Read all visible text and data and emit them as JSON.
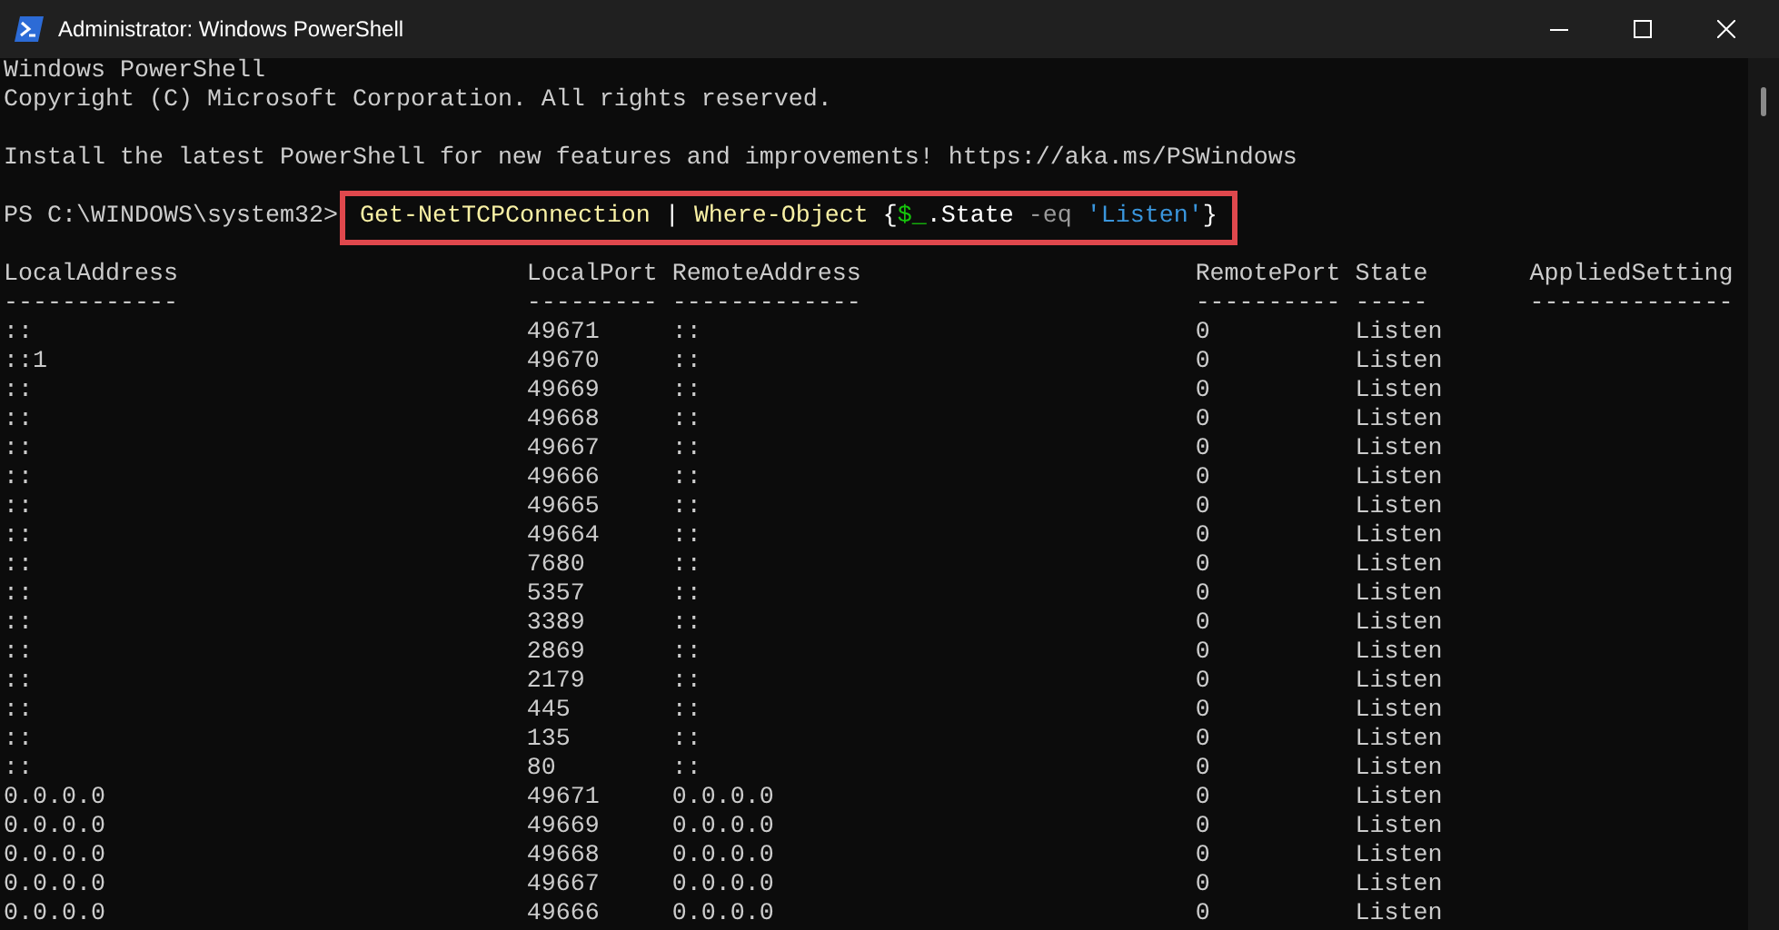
{
  "window": {
    "title": "Administrator: Windows PowerShell"
  },
  "console": {
    "banner": [
      [
        "Windows PowerShell",
        "Copyright (C) Microsoft Corporation. All rights reserved."
      ],
      [
        "Install the latest PowerShell for new features and improvements! https://aka.ms/PSWindows"
      ]
    ],
    "prompt": "PS C:\\WINDOWS\\system32>",
    "command": {
      "highlighted": true,
      "segments": [
        {
          "kind": "command",
          "text": "Get-NetTCPConnection"
        },
        {
          "kind": "plain",
          "text": " | "
        },
        {
          "kind": "command",
          "text": "Where-Object"
        },
        {
          "kind": "plain",
          "text": " {"
        },
        {
          "kind": "variable",
          "text": "$_"
        },
        {
          "kind": "plain",
          "text": ".State "
        },
        {
          "kind": "operator",
          "text": "-eq "
        },
        {
          "kind": "string",
          "text": "'Listen'"
        },
        {
          "kind": "plain",
          "text": "}"
        }
      ]
    },
    "table": {
      "columns": [
        {
          "header": "LocalAddress",
          "underline": "------------"
        },
        {
          "header": "LocalPort",
          "underline": "---------"
        },
        {
          "header": "RemoteAddress",
          "underline": "-------------"
        },
        {
          "header": "RemotePort",
          "underline": "----------"
        },
        {
          "header": "State",
          "underline": "-----"
        },
        {
          "header": "AppliedSetting",
          "underline": "--------------"
        }
      ],
      "rows": [
        [
          "::",
          "49671",
          "::",
          "0",
          "Listen"
        ],
        [
          "::1",
          "49670",
          "::",
          "0",
          "Listen"
        ],
        [
          "::",
          "49669",
          "::",
          "0",
          "Listen"
        ],
        [
          "::",
          "49668",
          "::",
          "0",
          "Listen"
        ],
        [
          "::",
          "49667",
          "::",
          "0",
          "Listen"
        ],
        [
          "::",
          "49666",
          "::",
          "0",
          "Listen"
        ],
        [
          "::",
          "49665",
          "::",
          "0",
          "Listen"
        ],
        [
          "::",
          "49664",
          "::",
          "0",
          "Listen"
        ],
        [
          "::",
          "7680",
          "::",
          "0",
          "Listen"
        ],
        [
          "::",
          "5357",
          "::",
          "0",
          "Listen"
        ],
        [
          "::",
          "3389",
          "::",
          "0",
          "Listen"
        ],
        [
          "::",
          "2869",
          "::",
          "0",
          "Listen"
        ],
        [
          "::",
          "2179",
          "::",
          "0",
          "Listen"
        ],
        [
          "::",
          "445",
          "::",
          "0",
          "Listen"
        ],
        [
          "::",
          "135",
          "::",
          "0",
          "Listen"
        ],
        [
          "::",
          "80",
          "::",
          "0",
          "Listen"
        ],
        [
          "0.0.0.0",
          "49671",
          "0.0.0.0",
          "0",
          "Listen"
        ],
        [
          "0.0.0.0",
          "49669",
          "0.0.0.0",
          "0",
          "Listen"
        ],
        [
          "0.0.0.0",
          "49668",
          "0.0.0.0",
          "0",
          "Listen"
        ],
        [
          "0.0.0.0",
          "49667",
          "0.0.0.0",
          "0",
          "Listen"
        ],
        [
          "0.0.0.0",
          "49666",
          "0.0.0.0",
          "0",
          "Listen"
        ]
      ]
    }
  }
}
